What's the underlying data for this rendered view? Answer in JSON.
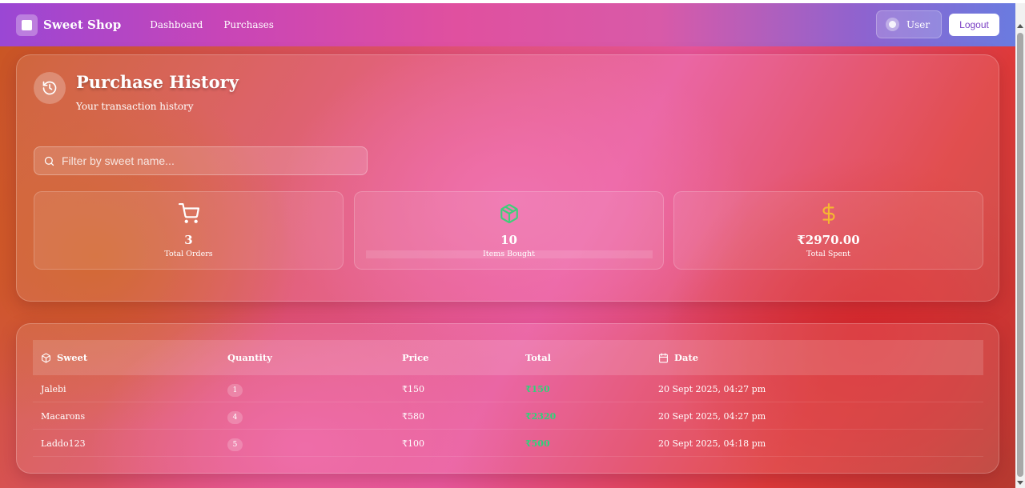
{
  "navbar": {
    "brand": "Sweet Shop",
    "links": [
      "Dashboard",
      "Purchases"
    ],
    "user_label": "User",
    "logout_label": "Logout"
  },
  "header": {
    "title": "Purchase History",
    "subtitle": "Your transaction history"
  },
  "search": {
    "placeholder": "Filter by sweet name..."
  },
  "stats": [
    {
      "icon": "cart-icon",
      "value": "3",
      "label": "Total Orders",
      "color": "#ffffff"
    },
    {
      "icon": "package-icon",
      "value": "10",
      "label": "Items Bought",
      "color": "#3ecf7a"
    },
    {
      "icon": "dollar-icon",
      "value": "₹2970.00",
      "label": "Total Spent",
      "color": "#f5b731"
    }
  ],
  "table": {
    "headers": {
      "sweet": "Sweet",
      "quantity": "Quantity",
      "price": "Price",
      "total": "Total",
      "date": "Date"
    },
    "rows": [
      {
        "sweet": "Jalebi",
        "quantity": "1",
        "price": "₹150",
        "total": "₹150",
        "date": "20 Sept 2025, 04:27 pm"
      },
      {
        "sweet": "Macarons",
        "quantity": "4",
        "price": "₹580",
        "total": "₹2320",
        "date": "20 Sept 2025, 04:27 pm"
      },
      {
        "sweet": "Laddo123",
        "quantity": "5",
        "price": "₹100",
        "total": "₹500",
        "date": "20 Sept 2025, 04:18 pm"
      }
    ]
  },
  "colors": {
    "accent_total": "#2fd27a",
    "logout_text": "#7a3fc4"
  }
}
